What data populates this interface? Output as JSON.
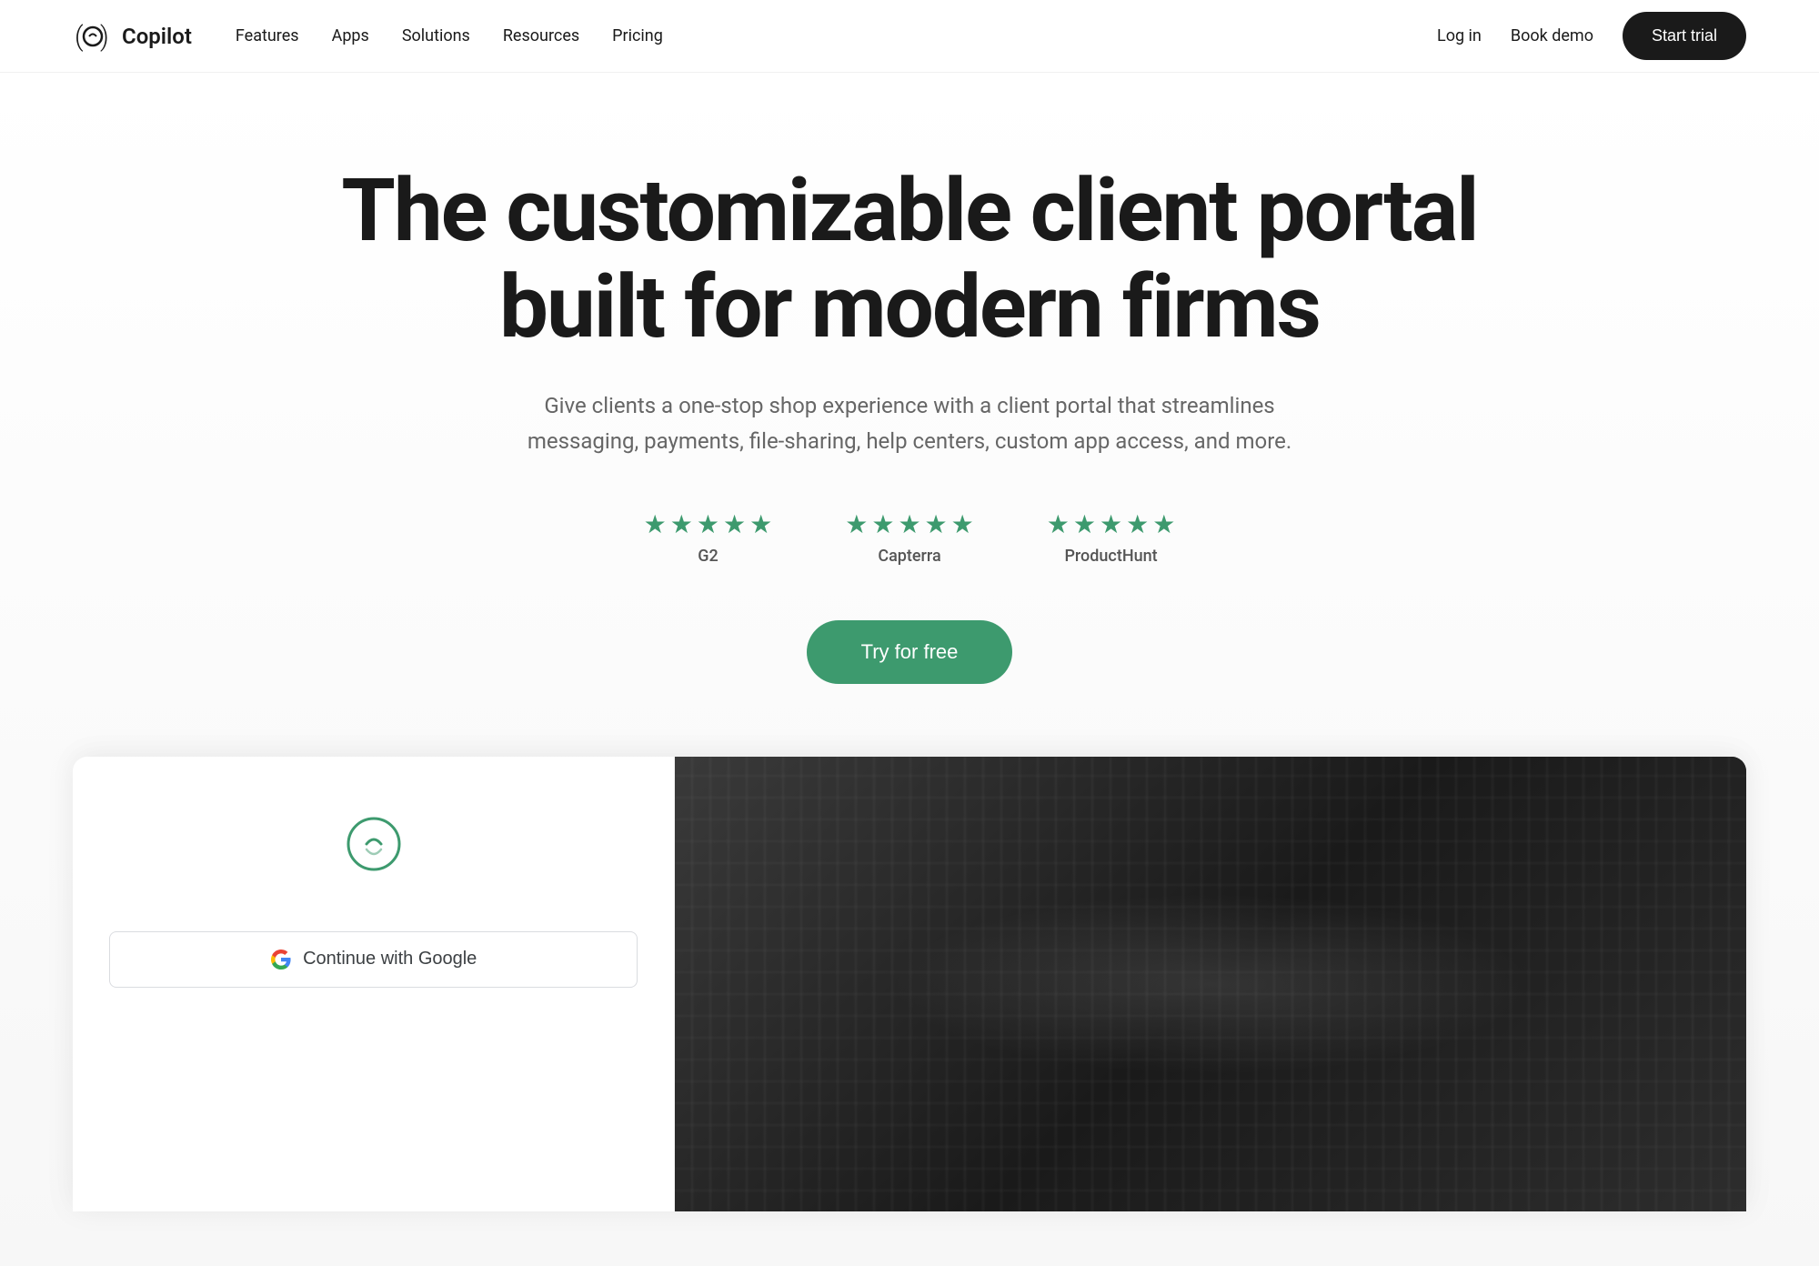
{
  "nav": {
    "logo_text": "Copilot",
    "links": [
      {
        "label": "Features",
        "id": "features"
      },
      {
        "label": "Apps",
        "id": "apps"
      },
      {
        "label": "Solutions",
        "id": "solutions"
      },
      {
        "label": "Resources",
        "id": "resources"
      },
      {
        "label": "Pricing",
        "id": "pricing"
      }
    ],
    "login_label": "Log in",
    "book_demo_label": "Book demo",
    "start_trial_label": "Start trial"
  },
  "hero": {
    "title": "The customizable client portal built for modern firms",
    "subtitle": "Give clients a one-stop shop experience with a client portal that streamlines messaging, payments, file-sharing, help centers, custom app access, and more.",
    "cta_label": "Try for free",
    "ratings": [
      {
        "platform": "G2",
        "stars": 5
      },
      {
        "platform": "Capterra",
        "stars": 5
      },
      {
        "platform": "ProductHunt",
        "stars": 5
      }
    ]
  },
  "demo": {
    "google_signin_label": "Continue with Google"
  },
  "colors": {
    "accent_green": "#3d9a6e",
    "dark": "#1a1a1a",
    "white": "#ffffff"
  }
}
